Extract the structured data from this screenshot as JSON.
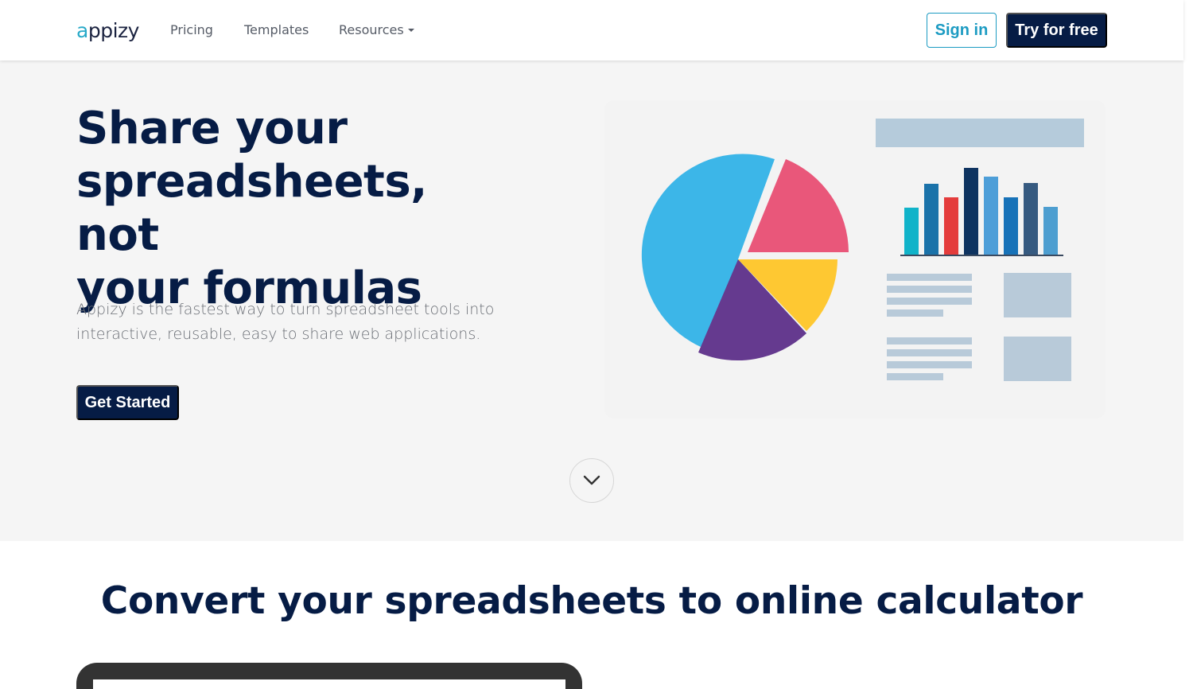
{
  "header": {
    "logo_a": "a",
    "logo_rest": "ppizy",
    "nav": {
      "pricing": "Pricing",
      "templates": "Templates",
      "resources": "Resources"
    },
    "sign_in": "Sign in",
    "try_free": "Try for free"
  },
  "hero": {
    "title_line1": "Share your",
    "title_line2": "spreadsheets, not",
    "title_line3": "your formulas",
    "subtitle_line1": "Appizy is the fastest way to turn spreadsheet tools into",
    "subtitle_line2": "interactive, reusable, easy to share web applications.",
    "cta": "Get Started"
  },
  "section": {
    "title": "Convert your spreadsheets to online calculator"
  },
  "colors": {
    "navy": "#061c45",
    "accent": "#1c9bc2",
    "hero_bg": "#f5f5f5"
  },
  "icons": {
    "scroll": "chevron-down-icon",
    "resources_caret": "caret-down-icon"
  }
}
